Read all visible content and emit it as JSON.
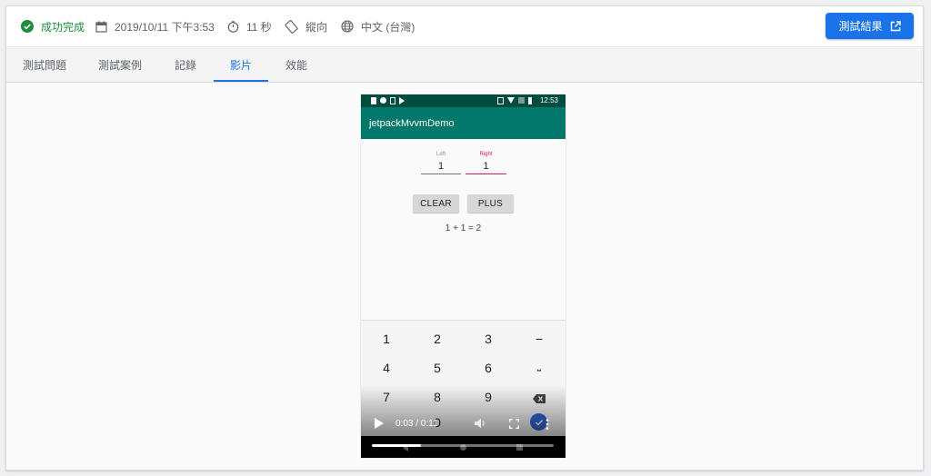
{
  "header": {
    "status": "成功完成",
    "date": "2019/10/11 下午3:53",
    "duration": "11 秒",
    "orientation": "縱向",
    "locale": "中文 (台灣)",
    "results_button": "測試結果"
  },
  "tabs": [
    {
      "label": "測試問題"
    },
    {
      "label": "測試案例"
    },
    {
      "label": "記錄"
    },
    {
      "label": "影片",
      "active": true
    },
    {
      "label": "效能"
    }
  ],
  "phone": {
    "time": "12:53",
    "app_title": "jetpackMvvmDemo",
    "left_label": "Left",
    "left_value": "1",
    "right_label": "Right",
    "right_value": "1",
    "clear_button": "CLEAR",
    "plus_button": "PLUS",
    "result": "1 + 1 = 2",
    "keyboard": {
      "row1": [
        "1",
        "2",
        "3",
        "−"
      ],
      "row2": [
        "4",
        "5",
        "6",
        "⎵"
      ],
      "row3": [
        "7",
        "8",
        "9"
      ],
      "row4_partial": "0"
    }
  },
  "video": {
    "time_display": "0:03 / 0:11",
    "progress": 0.27
  },
  "colors": {
    "success": "#1e8e3e",
    "accent": "#1a73e8",
    "app_bar": "#00796b",
    "status_bar": "#004d40",
    "focus": "#d81b60"
  }
}
